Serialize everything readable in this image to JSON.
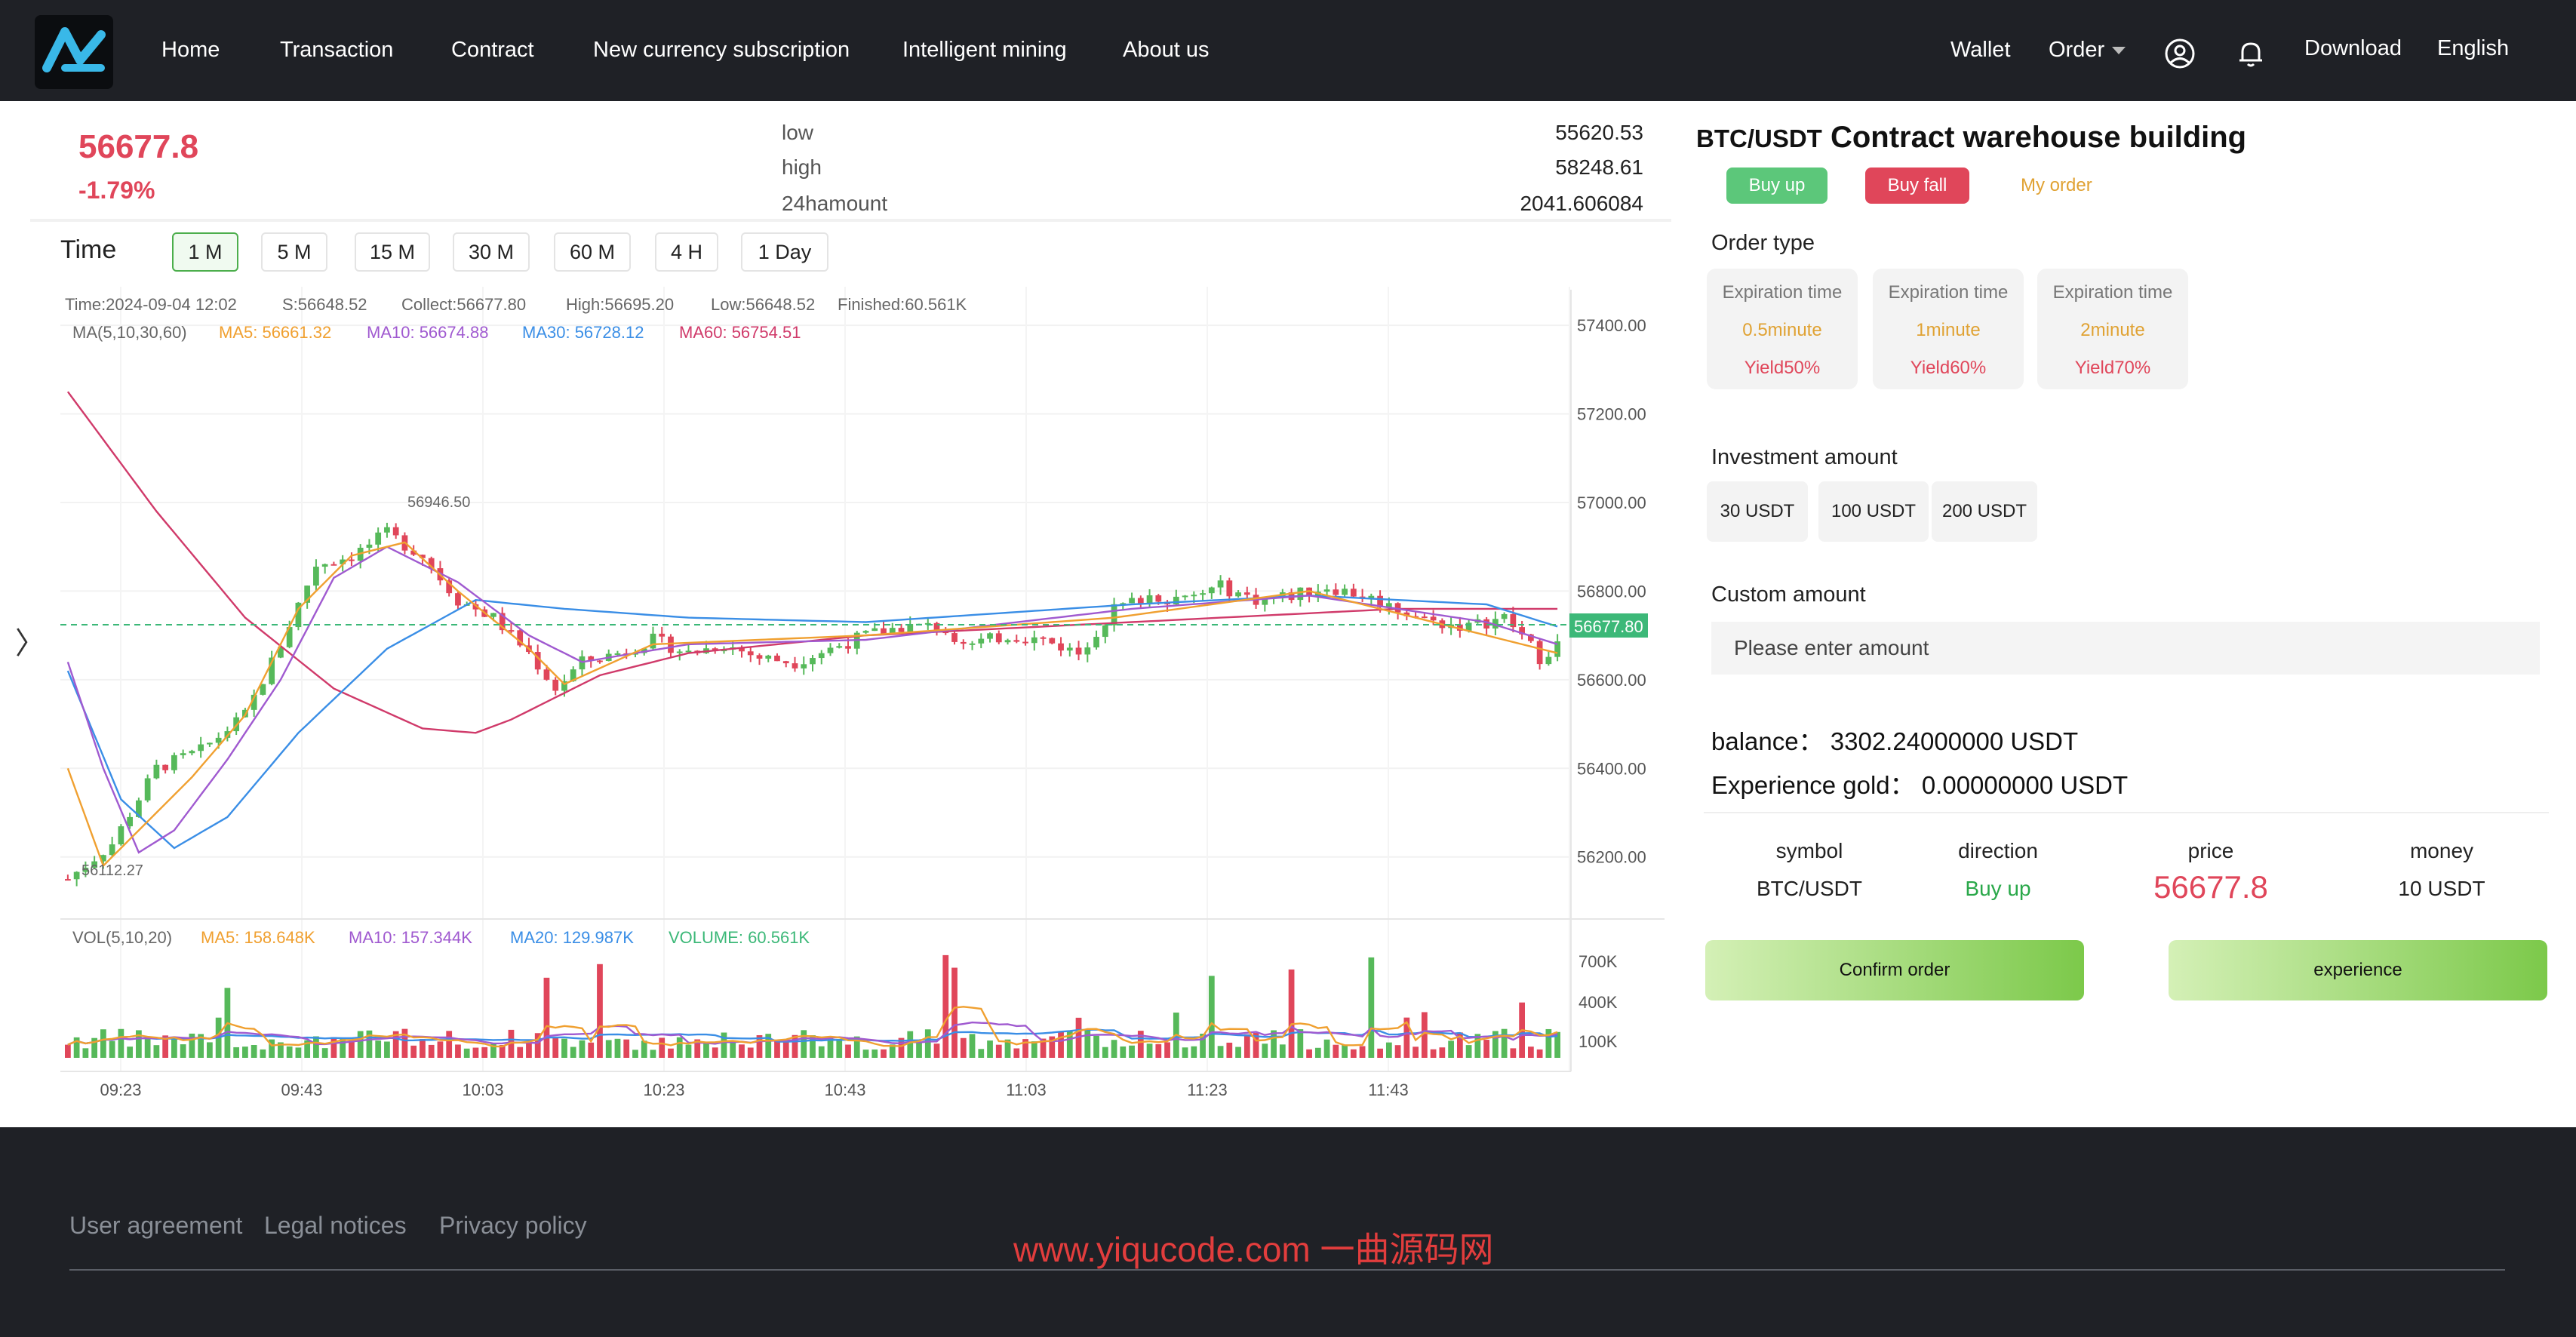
{
  "nav": {
    "items": [
      "Home",
      "Transaction",
      "Contract",
      "New currency subscription",
      "Intelligent mining",
      "About us"
    ],
    "wallet": "Wallet",
    "order": "Order",
    "download": "Download",
    "language": "English"
  },
  "ticker": {
    "price": "56677.8",
    "change": "-1.79%",
    "low_label": "low",
    "low": "55620.53",
    "high_label": "high",
    "high": "58248.61",
    "amount_label": "24hamount",
    "amount": "2041.606084"
  },
  "timeframes": {
    "time_label": "Time",
    "items": [
      "1 M",
      "5 M",
      "15 M",
      "30 M",
      "60 M",
      "4 H",
      "1 Day"
    ],
    "active": "1 M"
  },
  "chart_info": {
    "line1": [
      "Time:2024-09-04 12:02",
      "S:56648.52",
      "Collect:56677.80",
      "High:56695.20",
      "Low:56648.52",
      "Finished:60.561K"
    ],
    "ma_label": "MA(5,10,30,60)",
    "ma5": "MA5: 56661.32",
    "ma10": "MA10: 56674.88",
    "ma30": "MA30: 56728.12",
    "ma60": "MA60: 56754.51",
    "vol_label": "VOL(5,10,20)",
    "vol_ma5": "MA5: 158.648K",
    "vol_ma10": "MA10: 157.344K",
    "vol_ma20": "MA20: 129.987K",
    "vol_volume": "VOLUME: 60.561K",
    "max_marker": "56946.50",
    "min_marker": "56112.27",
    "current_label": "56677.80"
  },
  "chart_data": {
    "type": "candlestick",
    "yticks": [
      "57400.00",
      "57200.00",
      "57000.00",
      "56800.00",
      "56600.00",
      "56400.00",
      "56200.00"
    ],
    "ylim": [
      56065,
      57470
    ],
    "vol_ticks": [
      "700K",
      "400K",
      "100K"
    ],
    "xticks": [
      "09:23",
      "09:43",
      "10:03",
      "10:23",
      "10:43",
      "11:03",
      "11:23",
      "11:43"
    ],
    "anchors": [
      [
        0,
        56150
      ],
      [
        5,
        56230
      ],
      [
        10,
        56400
      ],
      [
        15,
        56440
      ],
      [
        20,
        56520
      ],
      [
        24,
        56680
      ],
      [
        28,
        56860
      ],
      [
        32,
        56880
      ],
      [
        36,
        56930
      ],
      [
        40,
        56880
      ],
      [
        44,
        56780
      ],
      [
        48,
        56740
      ],
      [
        52,
        56660
      ],
      [
        55,
        56580
      ],
      [
        58,
        56640
      ],
      [
        62,
        56660
      ],
      [
        66,
        56690
      ],
      [
        70,
        56660
      ],
      [
        74,
        56680
      ],
      [
        78,
        56650
      ],
      [
        82,
        56640
      ],
      [
        86,
        56670
      ],
      [
        90,
        56700
      ],
      [
        94,
        56720
      ],
      [
        98,
        56720
      ],
      [
        102,
        56680
      ],
      [
        106,
        56700
      ],
      [
        110,
        56690
      ],
      [
        114,
        56660
      ],
      [
        118,
        56760
      ],
      [
        122,
        56790
      ],
      [
        126,
        56780
      ],
      [
        130,
        56810
      ],
      [
        134,
        56780
      ],
      [
        138,
        56790
      ],
      [
        142,
        56810
      ],
      [
        146,
        56790
      ],
      [
        150,
        56760
      ],
      [
        154,
        56730
      ],
      [
        158,
        56720
      ],
      [
        162,
        56740
      ],
      [
        164,
        56700
      ],
      [
        166,
        56650
      ],
      [
        168,
        56680
      ]
    ],
    "ma60_anchors": [
      [
        0,
        57250
      ],
      [
        10,
        56980
      ],
      [
        20,
        56740
      ],
      [
        30,
        56580
      ],
      [
        40,
        56490
      ],
      [
        46,
        56480
      ],
      [
        50,
        56510
      ],
      [
        60,
        56610
      ],
      [
        70,
        56660
      ],
      [
        90,
        56700
      ],
      [
        110,
        56720
      ],
      [
        130,
        56740
      ],
      [
        150,
        56760
      ],
      [
        168,
        56760
      ]
    ],
    "ma30_anchors": [
      [
        0,
        56620
      ],
      [
        6,
        56330
      ],
      [
        12,
        56220
      ],
      [
        18,
        56290
      ],
      [
        26,
        56480
      ],
      [
        36,
        56670
      ],
      [
        46,
        56780
      ],
      [
        56,
        56760
      ],
      [
        70,
        56740
      ],
      [
        90,
        56730
      ],
      [
        120,
        56770
      ],
      [
        140,
        56790
      ],
      [
        160,
        56770
      ],
      [
        168,
        56720
      ]
    ],
    "ma10_anchors": [
      [
        0,
        56640
      ],
      [
        4,
        56400
      ],
      [
        8,
        56210
      ],
      [
        12,
        56260
      ],
      [
        18,
        56420
      ],
      [
        24,
        56600
      ],
      [
        30,
        56830
      ],
      [
        36,
        56900
      ],
      [
        44,
        56820
      ],
      [
        52,
        56700
      ],
      [
        58,
        56640
      ],
      [
        70,
        56680
      ],
      [
        90,
        56690
      ],
      [
        120,
        56760
      ],
      [
        140,
        56790
      ],
      [
        160,
        56730
      ],
      [
        168,
        56680
      ]
    ],
    "ma5_anchors": [
      [
        0,
        56400
      ],
      [
        4,
        56180
      ],
      [
        8,
        56260
      ],
      [
        14,
        56380
      ],
      [
        20,
        56520
      ],
      [
        26,
        56760
      ],
      [
        32,
        56880
      ],
      [
        38,
        56910
      ],
      [
        44,
        56800
      ],
      [
        52,
        56670
      ],
      [
        56,
        56590
      ],
      [
        66,
        56680
      ],
      [
        90,
        56700
      ],
      [
        118,
        56740
      ],
      [
        140,
        56800
      ],
      [
        160,
        56700
      ],
      [
        168,
        56660
      ]
    ]
  },
  "panel": {
    "pair": "BTC/USDT",
    "title": "Contract warehouse building",
    "buy_up": "Buy up",
    "buy_fall": "Buy fall",
    "my_order": "My order",
    "order_type_label": "Order type",
    "expiration": [
      {
        "label": "Expiration time",
        "time": "0.5minute",
        "yield": "Yield50%"
      },
      {
        "label": "Expiration time",
        "time": "1minute",
        "yield": "Yield60%"
      },
      {
        "label": "Expiration time",
        "time": "2minute",
        "yield": "Yield70%"
      }
    ],
    "investment_label": "Investment amount",
    "amounts": [
      "30 USDT",
      "100 USDT",
      "200 USDT"
    ],
    "custom_label": "Custom amount",
    "custom_placeholder": "Please enter amount",
    "balance": "balance： 3302.24000000 USDT",
    "experience_gold": "Experience gold： 0.00000000 USDT",
    "cols": {
      "symbol_label": "symbol",
      "symbol": "BTC/USDT",
      "direction_label": "direction",
      "direction": "Buy up",
      "price_label": "price",
      "price": "56677.8",
      "money_label": "money",
      "money": "10 USDT"
    },
    "confirm": "Confirm order",
    "experience": "experience"
  },
  "footer": {
    "links": [
      "User agreement",
      "Legal notices",
      "Privacy policy"
    ],
    "watermark": "www.yiqucode.com 一曲源码网"
  },
  "colors": {
    "up": "#56b95a",
    "down": "#e0465a",
    "ma5": "#f0a030",
    "ma10": "#a05ad0",
    "ma30": "#3a8ee6",
    "ma60": "#d03a6a",
    "nav_bg": "#1f2126"
  }
}
